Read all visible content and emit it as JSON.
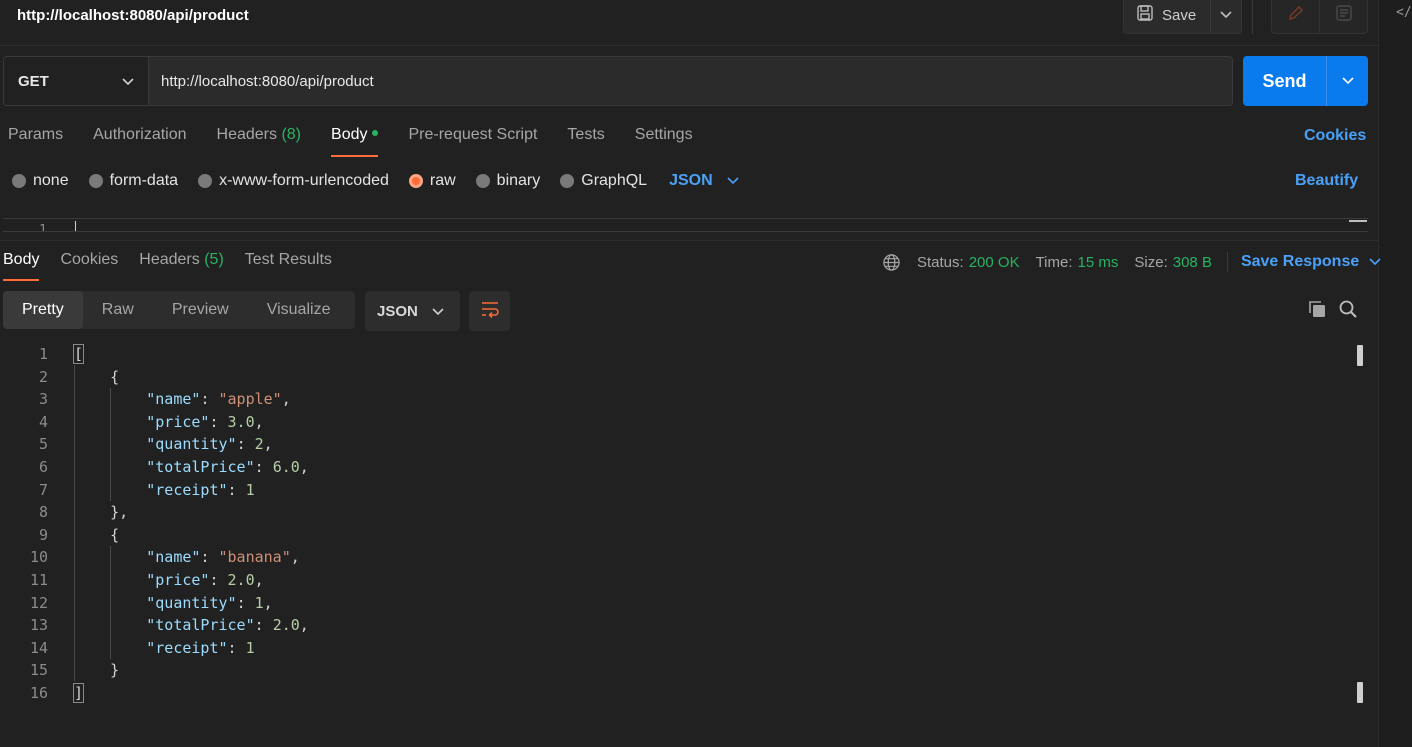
{
  "header": {
    "title": "http://localhost:8080/api/product",
    "save_label": "Save"
  },
  "request": {
    "method": "GET",
    "url": "http://localhost:8080/api/product",
    "send_label": "Send"
  },
  "request_tabs": [
    {
      "label": "Params"
    },
    {
      "label": "Authorization"
    },
    {
      "label": "Headers",
      "count": "(8)"
    },
    {
      "label": "Body"
    },
    {
      "label": "Pre-request Script"
    },
    {
      "label": "Tests"
    },
    {
      "label": "Settings"
    }
  ],
  "cookies_label": "Cookies",
  "body_types": [
    {
      "label": "none"
    },
    {
      "label": "form-data"
    },
    {
      "label": "x-www-form-urlencoded"
    },
    {
      "label": "raw"
    },
    {
      "label": "binary"
    },
    {
      "label": "GraphQL"
    }
  ],
  "raw_format": "JSON",
  "beautify_label": "Beautify",
  "request_editor": {
    "line_number": "1",
    "first_char": "["
  },
  "response_tabs": [
    {
      "label": "Body"
    },
    {
      "label": "Cookies"
    },
    {
      "label": "Headers",
      "count": "(5)"
    },
    {
      "label": "Test Results"
    }
  ],
  "response_meta": {
    "status_label": "Status:",
    "status_value": "200 OK",
    "time_label": "Time:",
    "time_value": "15 ms",
    "size_label": "Size:",
    "size_value": "308 B",
    "save_response_label": "Save Response"
  },
  "view_tabs": [
    {
      "label": "Pretty"
    },
    {
      "label": "Raw"
    },
    {
      "label": "Preview"
    },
    {
      "label": "Visualize"
    }
  ],
  "response_format": "JSON",
  "response_body": {
    "line_numbers": [
      "1",
      "2",
      "3",
      "4",
      "5",
      "6",
      "7",
      "8",
      "9",
      "10",
      "11",
      "12",
      "13",
      "14",
      "15",
      "16"
    ],
    "items": [
      {
        "name": "\"apple\"",
        "price": "3.0",
        "quantity": "2",
        "totalPrice": "6.0",
        "receipt": "1"
      },
      {
        "name": "\"banana\"",
        "price": "2.0",
        "quantity": "1",
        "totalPrice": "2.0",
        "receipt": "1"
      }
    ],
    "keys": {
      "name": "\"name\"",
      "price": "\"price\"",
      "quantity": "\"quantity\"",
      "totalPrice": "\"totalPrice\"",
      "receipt": "\"receipt\""
    }
  },
  "colors": {
    "accent_orange": "#ff6c37",
    "send_blue": "#097bed",
    "link_blue": "#4aa1f7",
    "status_green": "#28b363"
  }
}
